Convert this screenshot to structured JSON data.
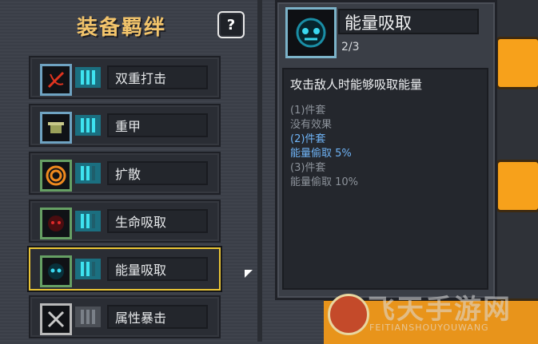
{
  "panel": {
    "title": "装备羁绊",
    "help_label": "?"
  },
  "bonds": [
    {
      "label": "双重打击",
      "icon": "double-strike-icon",
      "border": "blue",
      "bars_active": 3
    },
    {
      "label": "重甲",
      "icon": "heavy-armor-icon",
      "border": "blue",
      "bars_active": 3
    },
    {
      "label": "扩散",
      "icon": "spread-icon",
      "border": "green",
      "bars_active": 2
    },
    {
      "label": "生命吸取",
      "icon": "life-steal-icon",
      "border": "green",
      "bars_active": 2
    },
    {
      "label": "能量吸取",
      "icon": "energy-steal-icon",
      "border": "green",
      "bars_active": 2,
      "selected": true
    },
    {
      "label": "属性暴击",
      "icon": "attribute-crit-icon",
      "border": "grey",
      "bars_active": 0
    }
  ],
  "tooltip": {
    "name": "能量吸取",
    "count": "2/3",
    "description": "攻击敌人时能够吸取能量",
    "tiers": [
      {
        "title": "(1)件套",
        "effect": "没有效果",
        "active": false
      },
      {
        "title": "(2)件套",
        "effect": "能量偷取 5%",
        "active": true
      },
      {
        "title": "(3)件套",
        "effect": "能量偷取 10%",
        "active": false
      }
    ]
  },
  "watermark": {
    "text": "飞天手游网",
    "sub": "FEITIANSHOUYOUWANG"
  },
  "colors": {
    "title_gold": "#f2c46b",
    "active_tier_blue": "#6fb4f7",
    "selected_border": "#e9c536"
  }
}
